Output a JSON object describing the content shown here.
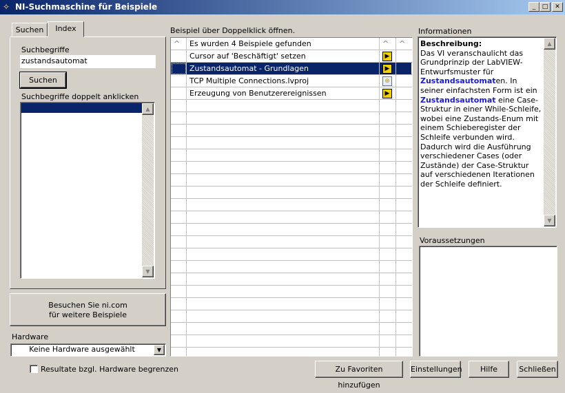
{
  "window": {
    "title": "NI-Suchmaschine für Beispiele",
    "minimize": "_",
    "maximize": "□",
    "close": "✕"
  },
  "tabs": [
    {
      "label": "Suchen"
    },
    {
      "label": "Index"
    }
  ],
  "index": {
    "search_label": "Suchbegriffe",
    "search_value": "zustandsautomat",
    "search_button": "Suchen",
    "list_label": "Suchbegriffe doppelt anklicken"
  },
  "visit_button": {
    "line1": "Besuchen Sie ni.com",
    "line2": "für weitere Beispiele"
  },
  "hardware": {
    "label": "Hardware",
    "selected": "Keine Hardware ausgewählt",
    "limit_checkbox_label": "Resultate bzgl. Hardware begrenzen",
    "limit_checked": false
  },
  "results": {
    "label": "Beispiel über Doppelklick öffnen.",
    "header": "Es wurden 4 Beispiele gefunden",
    "sort_glyph": "^",
    "rows": [
      {
        "name": "Cursor auf 'Beschäftigt' setzen",
        "icon": "vi-icon",
        "selected": false
      },
      {
        "name": "Zustandsautomat - Grundlagen",
        "icon": "vi-icon",
        "selected": true
      },
      {
        "name": "TCP Multiple Connections.lvproj",
        "icon": "project-icon",
        "selected": false
      },
      {
        "name": "Erzeugung von Benutzerereignissen",
        "icon": "vi-icon",
        "selected": false
      }
    ]
  },
  "info": {
    "label": "Informationen",
    "heading": "Beschreibung:",
    "t1": "Das VI veranschaulicht das Grundprinzip der LabVIEW-Entwurfsmuster für ",
    "k1": "Zustandsautomat",
    "t2": "en. In seiner einfachsten Form ist ein ",
    "k2": "Zustandsautomat",
    "t3": " eine Case-Struktur in einer While-Schleife, wobei eine Zustands-Enum mit einem Schieberegister der Schleife verbunden wird. Dadurch wird die Ausführung verschiedener Cases (oder Zustände) der Case-Struktur auf verschiedenen Iterationen der Schleife definiert.",
    "highlight_color": "#1a1adc"
  },
  "requirements": {
    "label": "Voraussetzungen"
  },
  "buttons": {
    "favorites": "Zu Favoriten hinzufügen",
    "settings": "Einstellungen",
    "help": "Hilfe",
    "close": "Schließen"
  }
}
